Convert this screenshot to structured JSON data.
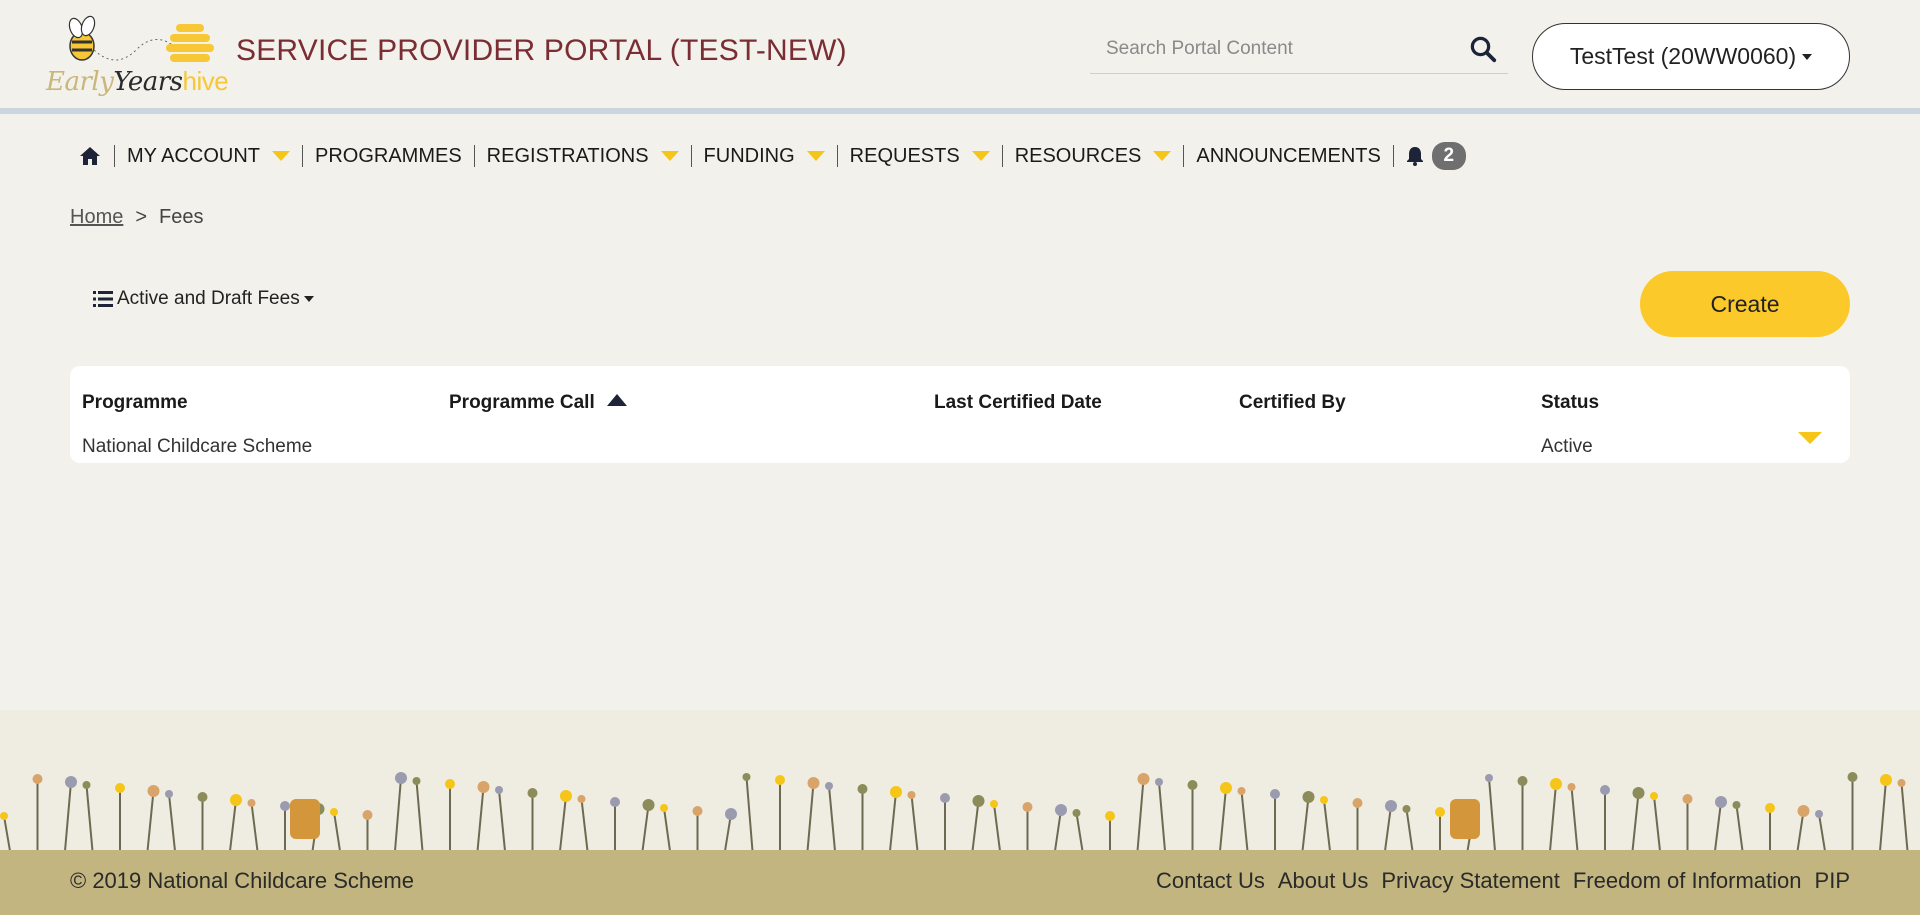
{
  "header": {
    "logo_text_early": "Early",
    "logo_text_years": "Years",
    "logo_text_hive": "hive",
    "portal_title": "SERVICE PROVIDER PORTAL (TEST-NEW)",
    "search_placeholder": "Search Portal Content",
    "account_label": "TestTest (20WW0060)"
  },
  "nav": {
    "items": [
      {
        "label": "MY ACCOUNT"
      },
      {
        "label": "PROGRAMMES"
      },
      {
        "label": "REGISTRATIONS"
      },
      {
        "label": "FUNDING"
      },
      {
        "label": "REQUESTS"
      },
      {
        "label": "RESOURCES"
      },
      {
        "label": "ANNOUNCEMENTS"
      }
    ],
    "notification_count": "2"
  },
  "breadcrumb": {
    "home": "Home",
    "separator": ">",
    "current": "Fees"
  },
  "view_selector": {
    "label": "Active and Draft Fees"
  },
  "create_label": "Create",
  "table": {
    "columns": [
      "Programme",
      "Programme Call",
      "Last Certified Date",
      "Certified By",
      "Status"
    ],
    "rows": [
      {
        "programme": "National Childcare Scheme",
        "programme_call": "",
        "last_certified_date": "",
        "certified_by": "",
        "status": "Active"
      }
    ]
  },
  "footer": {
    "copyright": "© 2019 National Childcare Scheme",
    "links": [
      "Contact Us",
      "About Us",
      "Privacy Statement",
      "Freedom of Information",
      "PIP"
    ]
  },
  "colors": {
    "title": "#7b2d34",
    "accent_yellow": "#fcc92a",
    "footer_bg": "#c3b57f",
    "page_bg": "#f3f1eb"
  }
}
